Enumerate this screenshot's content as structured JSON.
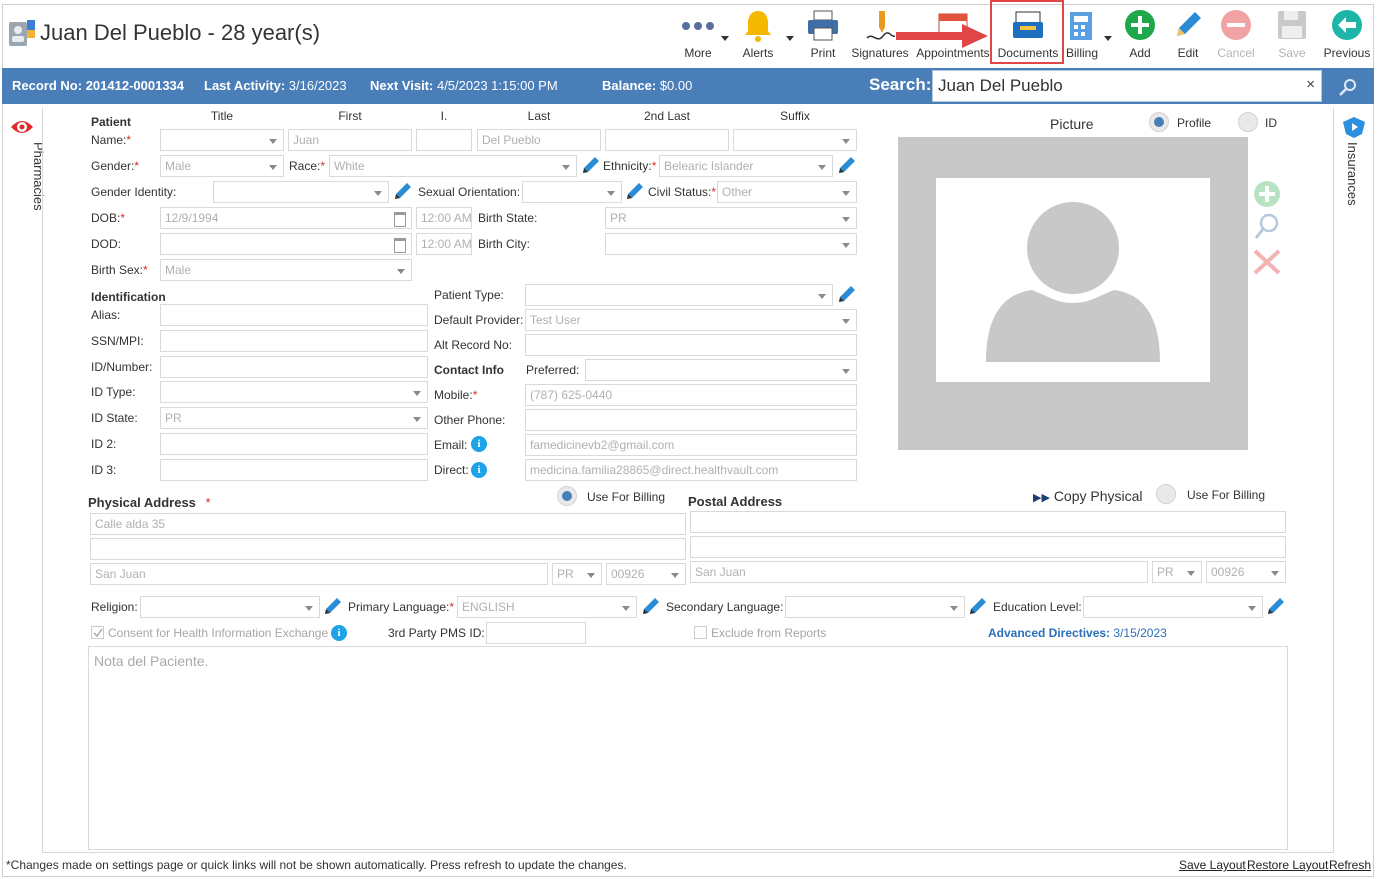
{
  "header": {
    "title": "Juan Del Pueblo - 28 year(s)"
  },
  "toolbar": {
    "more": "More",
    "alerts": "Alerts",
    "print": "Print",
    "signatures": "Signatures",
    "appointments": "Appointments",
    "documents": "Documents",
    "billing": "Billing",
    "add": "Add",
    "edit": "Edit",
    "cancel": "Cancel",
    "save": "Save",
    "previous": "Previous"
  },
  "infobar": {
    "record_label": "Record No:",
    "record_value": "201412-0001334",
    "activity_label": "Last Activity:",
    "activity_value": "3/16/2023",
    "visit_label": "Next Visit:",
    "visit_value": "4/5/2023 1:15:00 PM",
    "balance_label": "Balance:",
    "balance_value": "$0.00",
    "search_label": "Search:",
    "search_value": "Juan Del Pueblo",
    "search_clear": "×"
  },
  "sidebars": {
    "left": "Pharmacies",
    "right": "Insurances"
  },
  "columns": {
    "title": "Title",
    "first": "First",
    "initial": "I.",
    "last": "Last",
    "second_last": "2nd Last",
    "suffix": "Suffix"
  },
  "labels": {
    "patient": "Patient",
    "name": "Name:",
    "gender": "Gender:",
    "race": "Race:",
    "ethnicity": "Ethnicity:",
    "gender_identity": "Gender Identity:",
    "sexual_orientation": "Sexual Orientation:",
    "civil_status": "Civil Status:",
    "dob": "DOB:",
    "birth_state": "Birth State:",
    "dod": "DOD:",
    "birth_city": "Birth City:",
    "birth_sex": "Birth Sex:",
    "identification": "Identification",
    "alias": "Alias:",
    "ssn": "SSN/MPI:",
    "id_number": "ID/Number:",
    "id_type": "ID Type:",
    "id_state": "ID State:",
    "id2": "ID 2:",
    "id3": "ID 3:",
    "patient_type": "Patient Type:",
    "default_provider": "Default Provider:",
    "alt_record": "Alt Record No:",
    "contact_info": "Contact Info",
    "preferred": "Preferred:",
    "mobile": "Mobile:",
    "other_phone": "Other Phone:",
    "email": "Email:",
    "direct": "Direct:",
    "physical_address": "Physical Address",
    "use_for_billing": "Use For Billing",
    "postal_address": "Postal Address",
    "copy_physical": "Copy Physical",
    "religion": "Religion:",
    "primary_language": "Primary Language:",
    "secondary_language": "Secondary Language:",
    "education_level": "Education Level:",
    "consent": "Consent for Health Information Exchange",
    "third_party": "3rd Party PMS ID:",
    "exclude": "Exclude from Reports",
    "advanced_directives": "Advanced Directives:",
    "advanced_directives_date": "3/15/2023",
    "picture": "Picture",
    "profile": "Profile",
    "id": "ID",
    "required": "*"
  },
  "values": {
    "first": "Juan",
    "last": "Del Pueblo",
    "gender": "Male",
    "race": "White",
    "ethnicity": "Belearic Islander",
    "civil_status": "Other",
    "dob": "12/9/1994",
    "dob_time": "12:00 AM",
    "dod_time": "12:00 AM",
    "birth_state": "PR",
    "birth_sex": "Male",
    "id_state": "PR",
    "default_provider": "Test User",
    "mobile": "(787) 625-0440",
    "email": "famedicinevb2@gmail.com",
    "direct": "medicina.familia28865@direct.healthvault.com",
    "address1": "Calle alda 35",
    "city": "San Juan",
    "state": "PR",
    "zip": "00926",
    "postal_city": "San Juan",
    "postal_state": "PR",
    "postal_zip": "00926",
    "primary_language": "ENGLISH",
    "note_placeholder": "Nota del Paciente."
  },
  "footer": {
    "notice": "*Changes made on settings page or quick links will not be shown automatically. Press refresh to update the changes.",
    "save_layout": "Save Layout",
    "restore_layout": "Restore Layout",
    "refresh": "Refresh"
  },
  "colors": {
    "accent": "#4a7eb8",
    "highlight": "#e04646",
    "add": "#1fa84a"
  }
}
